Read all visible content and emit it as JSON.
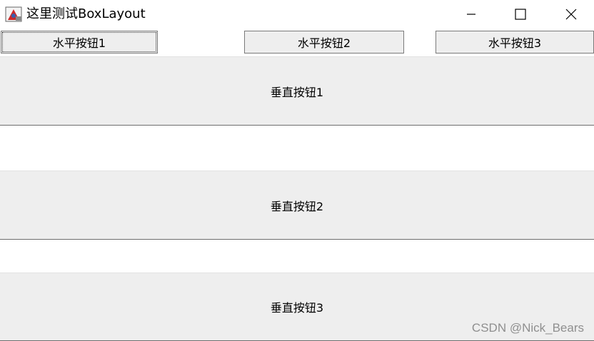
{
  "window": {
    "title": "这里测试BoxLayout",
    "icon": "java-app-icon",
    "controls": {
      "minimize": "minimize-icon",
      "maximize": "maximize-icon",
      "close": "close-icon"
    }
  },
  "horizontal_buttons": [
    {
      "label": "水平按钮1"
    },
    {
      "label": "水平按钮2"
    },
    {
      "label": "水平按钮3"
    }
  ],
  "vertical_buttons": [
    {
      "label": "垂直按钮1"
    },
    {
      "label": "垂直按钮2"
    },
    {
      "label": "垂直按钮3"
    }
  ],
  "watermark": "CSDN @Nick_Bears",
  "colors": {
    "button_bg": "#eeeeee",
    "window_bg": "#ffffff",
    "border": "#7a7a7a",
    "watermark": "#8f8f8f"
  }
}
